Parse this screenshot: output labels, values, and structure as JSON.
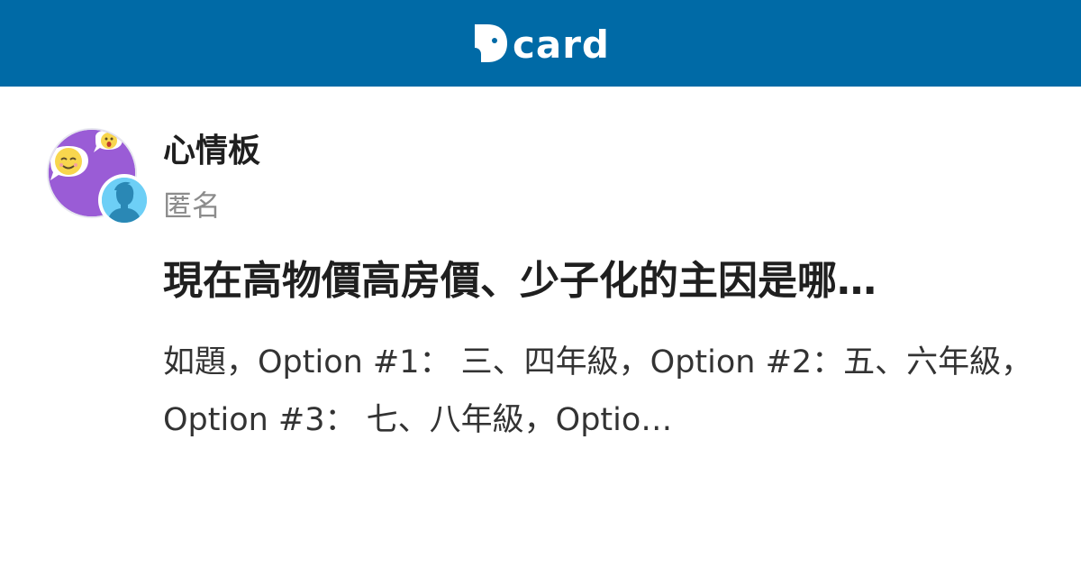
{
  "header": {
    "logo_text": "card",
    "background_color": "#006aa6",
    "logo_icon": "dcard-d-icon"
  },
  "post": {
    "forum_name": "心情板",
    "author": "匿名",
    "title": "現在高物價高房價、少子化的主因是哪…",
    "excerpt": "如題，Option #1： 三、四年級，Option #2：五、六年級，Option #3： 七、八年級，Optio…"
  },
  "avatars": {
    "forum_avatar_icon": "emoji-chat-bubbles-icon",
    "forum_avatar_color": "#9a5cd6",
    "user_avatar_icon": "anonymous-person-icon",
    "user_avatar_color": "#6dcff6"
  }
}
